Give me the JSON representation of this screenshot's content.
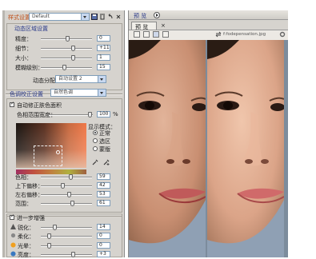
{
  "top": {
    "label": "样式设置：",
    "preset": "Default",
    "preview_title": "预  览"
  },
  "dyn": {
    "header": "动态区域设置",
    "sliders": [
      {
        "label": "精度：",
        "value": "0"
      },
      {
        "label": "细节：",
        "value": "+11"
      },
      {
        "label": "大小：",
        "value": "1"
      },
      {
        "label": "模糊级别：",
        "value": "15"
      }
    ],
    "combo_label": "动态分配：",
    "combo_value": "自动设置 2"
  },
  "color": {
    "header": "色调校正设置",
    "combo_value": "自然色调",
    "checkbox_label": "自动修正肤色面积",
    "checkbox_checked": true,
    "tolerance_label": "色相范围宽度：",
    "tolerance_value": "100",
    "tolerance_unit": "%",
    "mode_label": "显示模式：",
    "modes": [
      {
        "label": "正常",
        "checked": true
      },
      {
        "label": "选区",
        "checked": false
      },
      {
        "label": "蒙版",
        "checked": false
      }
    ],
    "sliders": [
      {
        "label": "色相：",
        "value": "59"
      },
      {
        "label": "上下偏移：",
        "value": "42"
      },
      {
        "label": "左右偏移：",
        "value": "53"
      },
      {
        "label": "范围：",
        "value": "61"
      }
    ]
  },
  "enhance": {
    "header": "进一步增强",
    "checked": true,
    "sliders": [
      {
        "label": "锐化：",
        "value": "14"
      },
      {
        "label": "柔化：",
        "value": "0"
      },
      {
        "label": "光晕：",
        "value": "0"
      },
      {
        "label": "亮度：",
        "value": "+3"
      }
    ]
  },
  "view": {
    "filename": "f:fodepensation.jpg"
  },
  "colors": {
    "panel": "#d6d3ce",
    "header_text": "#2a3a8a",
    "orange_text": "#c0501a"
  }
}
